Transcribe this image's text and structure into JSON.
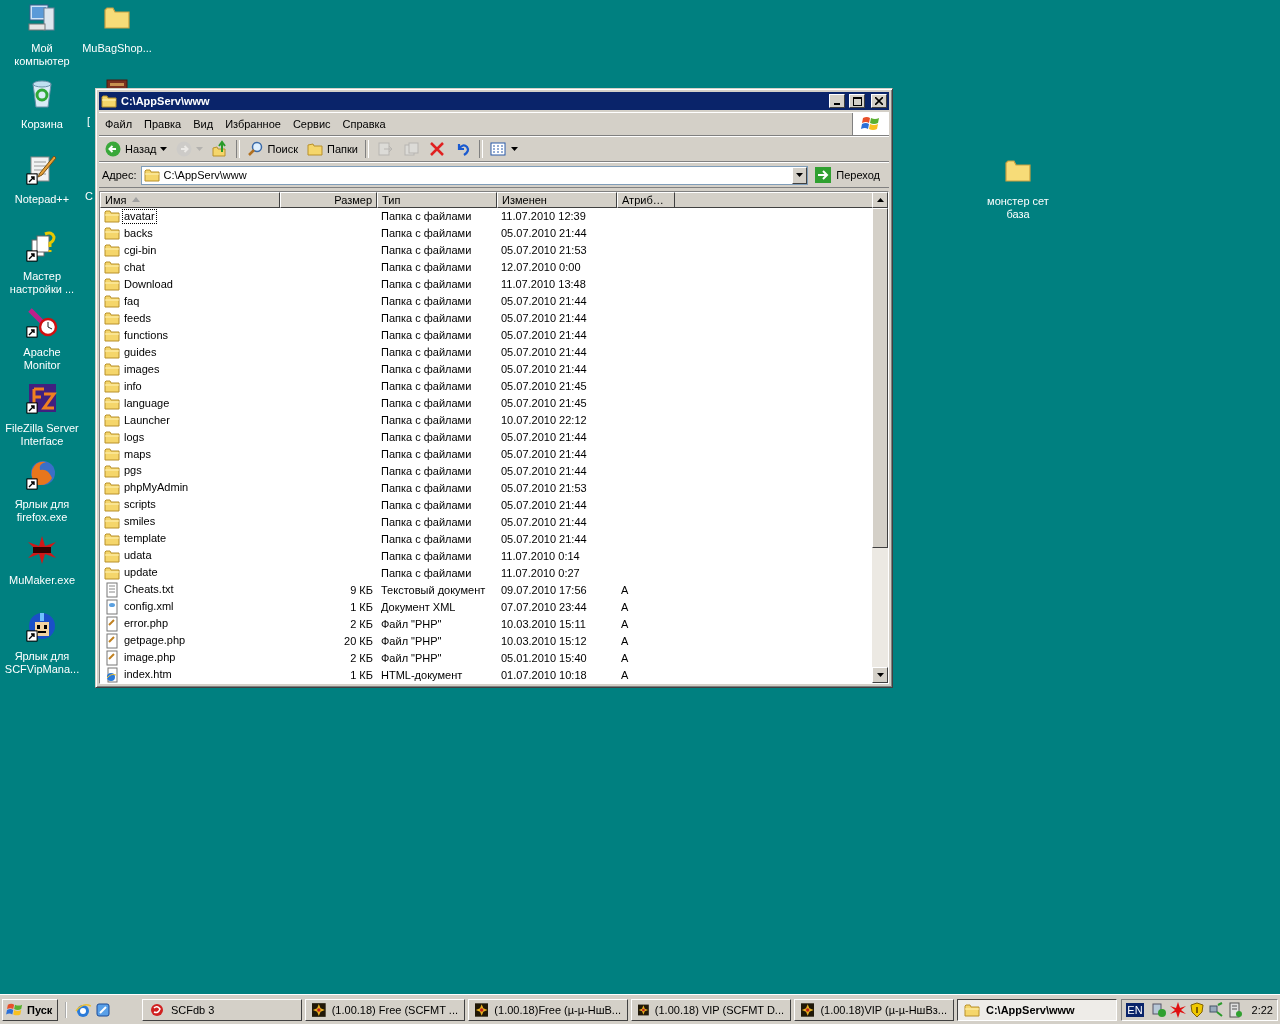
{
  "desktop_icons": [
    {
      "label": "Мой компьютер",
      "kind": "computer",
      "shortcut": false
    },
    {
      "label": "MuBagShop...",
      "kind": "folder",
      "shortcut": false
    },
    {
      "label": "Корзина",
      "kind": "recycle",
      "shortcut": false
    },
    {
      "label": "[",
      "kind": "book"
    },
    {
      "label": "Notepad++",
      "kind": "notepad",
      "shortcut": true
    },
    {
      "label": "C",
      "kind": "none"
    },
    {
      "label": "Мастер настройки ...",
      "kind": "wizard",
      "shortcut": true
    },
    {
      "label": "Apache Monitor",
      "kind": "apache",
      "shortcut": true
    },
    {
      "label": "FileZilla Server Interface",
      "kind": "filezilla",
      "shortcut": true
    },
    {
      "label": "Ярлык для firefox.exe",
      "kind": "firefox",
      "shortcut": true
    },
    {
      "label": "MuMaker.exe",
      "kind": "tmt",
      "shortcut": false
    },
    {
      "label": "Ярлык для SCFVipMana...",
      "kind": "robot",
      "shortcut": true
    },
    {
      "label": "монстер сет база",
      "kind": "folder",
      "shortcut": false
    }
  ],
  "window": {
    "title": "C:\\AppServ\\www",
    "menu": [
      "Файл",
      "Правка",
      "Вид",
      "Избранное",
      "Сервис",
      "Справка"
    ],
    "toolbar": [
      {
        "kind": "back",
        "label": "Назад",
        "disabled": false
      },
      {
        "kind": "forward",
        "disabled": true
      },
      {
        "kind": "up",
        "disabled": false
      },
      {
        "kind": "search",
        "label": "Поиск",
        "disabled": false
      },
      {
        "kind": "folders",
        "label": "Папки",
        "disabled": false
      },
      {
        "kind": "move",
        "disabled": true
      },
      {
        "kind": "copy",
        "disabled": true
      },
      {
        "kind": "delete",
        "disabled": false
      },
      {
        "kind": "undo",
        "disabled": false
      },
      {
        "kind": "views",
        "disabled": false
      }
    ],
    "address": {
      "label": "Адрес:",
      "value": "C:\\AppServ\\www",
      "go": "Переход"
    },
    "columns": [
      {
        "label": "Имя",
        "sorted": true
      },
      {
        "label": "Размер",
        "sorted": false
      },
      {
        "label": "Тип",
        "sorted": false
      },
      {
        "label": "Изменен",
        "sorted": false
      },
      {
        "label": "Атриб…",
        "sorted": false
      }
    ],
    "rows": [
      {
        "name": "avatar",
        "size": "",
        "type": "Папка с файлами",
        "modified": "11.07.2010 12:39",
        "attr": "",
        "kind": "folder",
        "focused": true
      },
      {
        "name": "backs",
        "size": "",
        "type": "Папка с файлами",
        "modified": "05.07.2010 21:44",
        "attr": "",
        "kind": "folder",
        "focused": false
      },
      {
        "name": "cgi-bin",
        "size": "",
        "type": "Папка с файлами",
        "modified": "05.07.2010 21:53",
        "attr": "",
        "kind": "folder",
        "focused": false
      },
      {
        "name": "chat",
        "size": "",
        "type": "Папка с файлами",
        "modified": "12.07.2010 0:00",
        "attr": "",
        "kind": "folder",
        "focused": false
      },
      {
        "name": "Download",
        "size": "",
        "type": "Папка с файлами",
        "modified": "11.07.2010 13:48",
        "attr": "",
        "kind": "folder",
        "focused": false
      },
      {
        "name": "faq",
        "size": "",
        "type": "Папка с файлами",
        "modified": "05.07.2010 21:44",
        "attr": "",
        "kind": "folder",
        "focused": false
      },
      {
        "name": "feeds",
        "size": "",
        "type": "Папка с файлами",
        "modified": "05.07.2010 21:44",
        "attr": "",
        "kind": "folder",
        "focused": false
      },
      {
        "name": "functions",
        "size": "",
        "type": "Папка с файлами",
        "modified": "05.07.2010 21:44",
        "attr": "",
        "kind": "folder",
        "focused": false
      },
      {
        "name": "guides",
        "size": "",
        "type": "Папка с файлами",
        "modified": "05.07.2010 21:44",
        "attr": "",
        "kind": "folder",
        "focused": false
      },
      {
        "name": "images",
        "size": "",
        "type": "Папка с файлами",
        "modified": "05.07.2010 21:44",
        "attr": "",
        "kind": "folder",
        "focused": false
      },
      {
        "name": "info",
        "size": "",
        "type": "Папка с файлами",
        "modified": "05.07.2010 21:45",
        "attr": "",
        "kind": "folder",
        "focused": false
      },
      {
        "name": "language",
        "size": "",
        "type": "Папка с файлами",
        "modified": "05.07.2010 21:45",
        "attr": "",
        "kind": "folder",
        "focused": false
      },
      {
        "name": "Launcher",
        "size": "",
        "type": "Папка с файлами",
        "modified": "10.07.2010 22:12",
        "attr": "",
        "kind": "folder",
        "focused": false
      },
      {
        "name": "logs",
        "size": "",
        "type": "Папка с файлами",
        "modified": "05.07.2010 21:44",
        "attr": "",
        "kind": "folder",
        "focused": false
      },
      {
        "name": "maps",
        "size": "",
        "type": "Папка с файлами",
        "modified": "05.07.2010 21:44",
        "attr": "",
        "kind": "folder",
        "focused": false
      },
      {
        "name": "pgs",
        "size": "",
        "type": "Папка с файлами",
        "modified": "05.07.2010 21:44",
        "attr": "",
        "kind": "folder",
        "focused": false
      },
      {
        "name": "phpMyAdmin",
        "size": "",
        "type": "Папка с файлами",
        "modified": "05.07.2010 21:53",
        "attr": "",
        "kind": "folder",
        "focused": false
      },
      {
        "name": "scripts",
        "size": "",
        "type": "Папка с файлами",
        "modified": "05.07.2010 21:44",
        "attr": "",
        "kind": "folder",
        "focused": false
      },
      {
        "name": "smiles",
        "size": "",
        "type": "Папка с файлами",
        "modified": "05.07.2010 21:44",
        "attr": "",
        "kind": "folder",
        "focused": false
      },
      {
        "name": "template",
        "size": "",
        "type": "Папка с файлами",
        "modified": "05.07.2010 21:44",
        "attr": "",
        "kind": "folder",
        "focused": false
      },
      {
        "name": "udata",
        "size": "",
        "type": "Папка с файлами",
        "modified": "11.07.2010 0:14",
        "attr": "",
        "kind": "folder",
        "focused": false
      },
      {
        "name": "update",
        "size": "",
        "type": "Папка с файлами",
        "modified": "11.07.2010 0:27",
        "attr": "",
        "kind": "folder",
        "focused": false
      },
      {
        "name": "Cheats.txt",
        "size": "9 КБ",
        "type": "Текстовый документ",
        "modified": "09.07.2010 17:56",
        "attr": "A",
        "kind": "text",
        "focused": false
      },
      {
        "name": "config.xml",
        "size": "1 КБ",
        "type": "Документ XML",
        "modified": "07.07.2010 23:44",
        "attr": "A",
        "kind": "xml",
        "focused": false
      },
      {
        "name": "error.php",
        "size": "2 КБ",
        "type": "Файл \"PHP\"",
        "modified": "10.03.2010 15:11",
        "attr": "A",
        "kind": "php",
        "focused": false
      },
      {
        "name": "getpage.php",
        "size": "20 КБ",
        "type": "Файл \"PHP\"",
        "modified": "10.03.2010 15:12",
        "attr": "A",
        "kind": "php",
        "focused": false
      },
      {
        "name": "image.php",
        "size": "2 КБ",
        "type": "Файл \"PHP\"",
        "modified": "05.01.2010 15:40",
        "attr": "A",
        "kind": "php",
        "focused": false
      },
      {
        "name": "index.htm",
        "size": "1 КБ",
        "type": "HTML-документ",
        "modified": "01.07.2010 10:18",
        "attr": "A",
        "kind": "html",
        "focused": false
      }
    ]
  },
  "taskbar": {
    "start": "Пуск",
    "tasks": [
      {
        "label": "SCFdb 3",
        "kind": "red",
        "selected": false
      },
      {
        "label": "(1.00.18) Free (SCFMT ...",
        "kind": "game",
        "selected": false
      },
      {
        "label": "(1.00.18)Free (µ-µ-НшВ...",
        "kind": "game",
        "selected": false
      },
      {
        "label": "(1.00.18) VIP (SCFMT D...",
        "kind": "game",
        "selected": false
      },
      {
        "label": "(1.00.18)VIP (µ-µ-НшВз...",
        "kind": "game",
        "selected": false
      },
      {
        "label": "C:\\AppServ\\www",
        "kind": "folder",
        "selected": true
      }
    ],
    "language": "EN",
    "clock": "2:22"
  }
}
